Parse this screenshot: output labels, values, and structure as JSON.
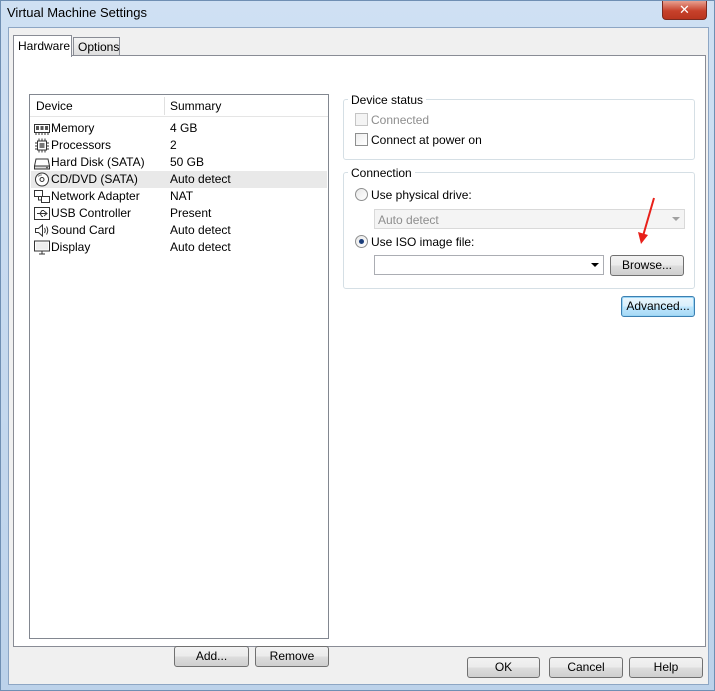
{
  "window": {
    "title": "Virtual Machine Settings",
    "close_label": "✕"
  },
  "tabs": [
    {
      "label": "Hardware",
      "active": true
    },
    {
      "label": "Options",
      "active": false
    }
  ],
  "device_list": {
    "columns": [
      "Device",
      "Summary"
    ],
    "rows": [
      {
        "device": "Memory",
        "summary": "4 GB",
        "icon": "memory-icon"
      },
      {
        "device": "Processors",
        "summary": "2",
        "icon": "processor-icon"
      },
      {
        "device": "Hard Disk (SATA)",
        "summary": "50 GB",
        "icon": "hard-disk-icon"
      },
      {
        "device": "CD/DVD (SATA)",
        "summary": "Auto detect",
        "icon": "cd-dvd-icon",
        "selected": true
      },
      {
        "device": "Network Adapter",
        "summary": "NAT",
        "icon": "network-adapter-icon"
      },
      {
        "device": "USB Controller",
        "summary": "Present",
        "icon": "usb-icon"
      },
      {
        "device": "Sound Card",
        "summary": "Auto detect",
        "icon": "speaker-icon"
      },
      {
        "device": "Display",
        "summary": "Auto detect",
        "icon": "monitor-icon"
      }
    ]
  },
  "list_buttons": {
    "add": "Add...",
    "remove": "Remove"
  },
  "device_status": {
    "title": "Device status",
    "connected_label": "Connected",
    "connected_checked": false,
    "connect_at_power_on_label": "Connect at power on",
    "connect_at_power_on_checked": false
  },
  "connection": {
    "title": "Connection",
    "physical_drive_label": "Use physical drive:",
    "physical_drive_value": "Auto detect",
    "iso_label": "Use ISO image file:",
    "iso_value": "",
    "selected": "iso",
    "browse_label": "Browse..."
  },
  "advanced_label": "Advanced...",
  "footer": {
    "ok": "OK",
    "cancel": "Cancel",
    "help": "Help"
  },
  "annotation": {
    "arrow_color": "#e8201a"
  }
}
